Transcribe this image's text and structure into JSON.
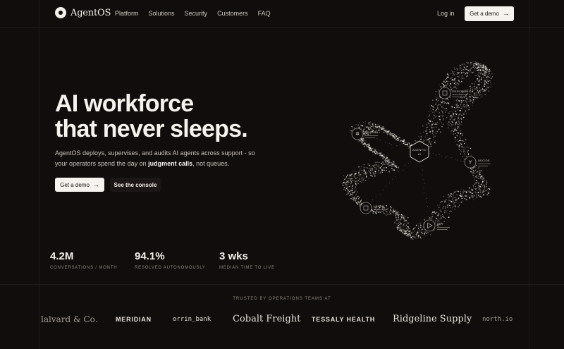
{
  "nav": {
    "brand": "AgentOS",
    "links": [
      "Platform",
      "Solutions",
      "Security",
      "Customers",
      "FAQ"
    ],
    "login": "Log in",
    "cta": "Get a demo"
  },
  "hero": {
    "title_line1": "AI workforce",
    "title_line2": "that never sleeps.",
    "desc_part1": "AgentOS deploys, supervises, and audits AI agents across support - so your operators spend the day on ",
    "desc_bold": "judgment calls",
    "desc_part2": ", not queues.",
    "primary_cta": "Get a demo",
    "secondary_cta": "See the console"
  },
  "diagram": {
    "center_line1": "AGENTIC",
    "center_line2": "AI",
    "nodes": {
      "perceive": "PERCEIVE",
      "reason": "REASON",
      "decide": "DECIDE",
      "learn": "LEARN",
      "act": "ACT"
    }
  },
  "stats": [
    {
      "value": "4.2M",
      "label": "CONVERSATIONS / MONTH"
    },
    {
      "value": "94.1%",
      "label": "RESOLVED AUTONOMOUSLY"
    },
    {
      "value": "3 wks",
      "label": "MEDIAN TIME TO LIVE"
    }
  ],
  "trusted": {
    "label": "TRUSTED BY OPERATIONS TEAMS AT",
    "logos": [
      "lalvard & Co.",
      "MERIDIAN",
      "orrin_bank",
      "Cobalt Freight",
      "TESSALY HEALTH",
      "Ridgeline Supply",
      "north.io"
    ]
  }
}
